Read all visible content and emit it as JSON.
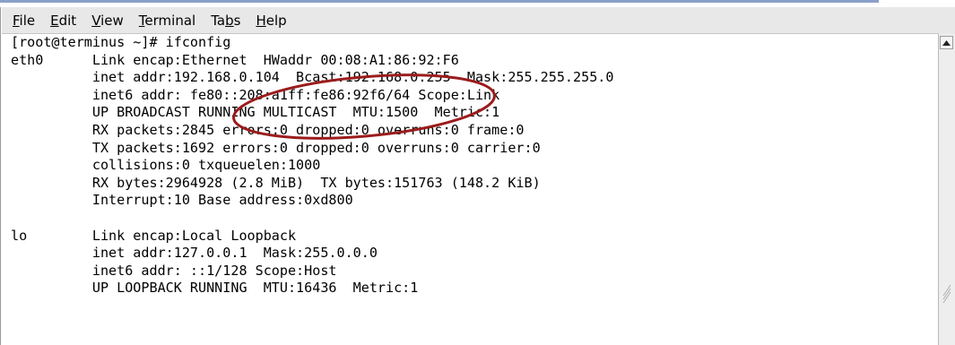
{
  "menubar": {
    "items": [
      {
        "label": "File",
        "mnemonic_index": 0
      },
      {
        "label": "Edit",
        "mnemonic_index": 0
      },
      {
        "label": "View",
        "mnemonic_index": 0
      },
      {
        "label": "Terminal",
        "mnemonic_index": 0
      },
      {
        "label": "Tabs",
        "mnemonic_index": 2
      },
      {
        "label": "Help",
        "mnemonic_index": 0
      }
    ]
  },
  "terminal": {
    "lines": [
      "[root@terminus ~]# ifconfig",
      "eth0      Link encap:Ethernet  HWaddr 00:08:A1:86:92:F6",
      "          inet addr:192.168.0.104  Bcast:192.168.0.255  Mask:255.255.255.0",
      "          inet6 addr: fe80::208:a1ff:fe86:92f6/64 Scope:Link",
      "          UP BROADCAST RUNNING MULTICAST  MTU:1500  Metric:1",
      "          RX packets:2845 errors:0 dropped:0 overruns:0 frame:0",
      "          TX packets:1692 errors:0 dropped:0 overruns:0 carrier:0",
      "          collisions:0 txqueuelen:1000",
      "          RX bytes:2964928 (2.8 MiB)  TX bytes:151763 (148.2 KiB)",
      "          Interrupt:10 Base address:0xd800",
      "",
      "lo        Link encap:Local Loopback",
      "          inet addr:127.0.0.1  Mask:255.0.0.0",
      "          inet6 addr: ::1/128 Scope:Host",
      "          UP LOOPBACK RUNNING  MTU:16436  Metric:1"
    ]
  },
  "annotation": {
    "color": "#9b1c1c"
  },
  "icons": {
    "scroll_up": "triangle-up",
    "resize_grip": "diagonal-lines"
  }
}
